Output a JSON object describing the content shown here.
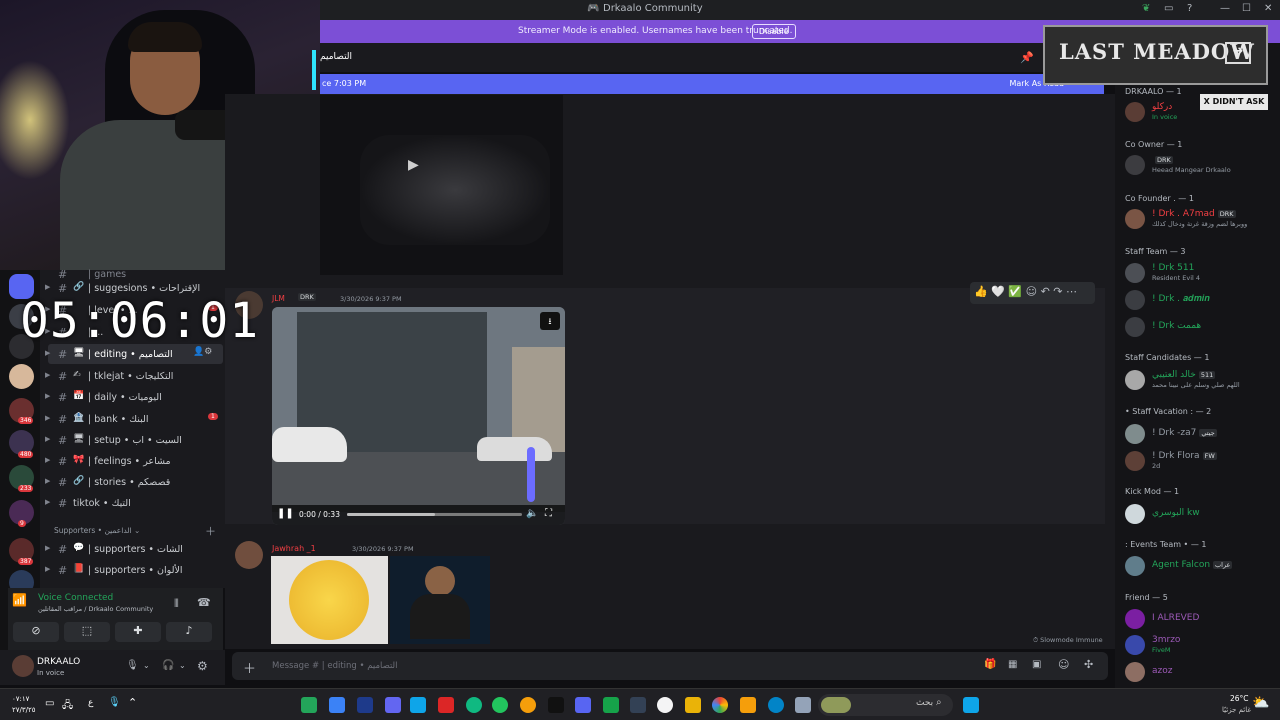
{
  "window": {
    "title": "Drkaalo Community",
    "controls": [
      "leaf-icon",
      "inbox-icon",
      "help-icon",
      "minimize-icon",
      "maximize-icon",
      "close-icon"
    ]
  },
  "banner": {
    "text": "Streamer Mode is enabled. Usernames have been truncated.",
    "button": "Disable",
    "color": "#7c4fd6"
  },
  "channel_header": {
    "name": "التصاميم"
  },
  "new_messages": {
    "left": "ce 7:03 PM",
    "right": "Mark As Read"
  },
  "timer": "05:06:01",
  "servers": [
    {
      "badge": ""
    },
    {
      "badge": ""
    },
    {
      "badge": ""
    },
    {
      "badge": "346"
    },
    {
      "badge": "480"
    },
    {
      "badge": "233"
    },
    {
      "badge": "9"
    },
    {
      "badge": "387"
    },
    {
      "badge": ""
    }
  ],
  "channels": [
    {
      "emoji": "🔗",
      "label": "| suggesions • الإقتراحات",
      "active": false,
      "badge": ""
    },
    {
      "emoji": "",
      "label": "| level • ...",
      "active": false,
      "badge": "1"
    },
    {
      "emoji": "",
      "label": "| ...",
      "active": false,
      "badge": ""
    },
    {
      "emoji": "🖥",
      "label": "| editing • التصاميم",
      "active": true,
      "badge": ""
    },
    {
      "emoji": "✍",
      "label": "| tklejat • التكليجات",
      "active": false,
      "badge": ""
    },
    {
      "emoji": "📅",
      "label": "| daily • اليوميات",
      "active": false,
      "badge": ""
    },
    {
      "emoji": "🏦",
      "label": "| bank • البنك",
      "active": false,
      "badge": "1"
    },
    {
      "emoji": "🖥",
      "label": "| setup • السيت • اب",
      "active": false,
      "badge": ""
    },
    {
      "emoji": "🎀",
      "label": "| feelings • مشاعر",
      "active": false,
      "badge": ""
    },
    {
      "emoji": "🔗",
      "label": "| stories • قصصكم",
      "active": false,
      "badge": ""
    },
    {
      "emoji": "",
      "label": "tiktok • التيك",
      "active": false,
      "badge": ""
    }
  ],
  "category": {
    "label": "Supporters • الداعمين"
  },
  "supporter_channels": [
    {
      "emoji": "💬",
      "label": "| supporters • الشات"
    },
    {
      "emoji": "📕",
      "label": "| supporters • الألوان"
    }
  ],
  "voice": {
    "status": "Voice Connected",
    "location": "مراقب المقاتلين / Drkaalo Community"
  },
  "user": {
    "name": "DRKAALO",
    "status": "In voice"
  },
  "messages": [
    {
      "author": "JLM",
      "tag": "DRK",
      "timestamp": "3/30/2026 9:37 PM",
      "video": {
        "time": "0:00 / 0:33",
        "progress": 0.0
      }
    },
    {
      "author": "Jawhrah _1",
      "timestamp": "3/30/2026 9:37 PM"
    }
  ],
  "slowmode": "Slowmode Immune",
  "input": {
    "placeholder": "Message # | editing • التصاميم"
  },
  "members": {
    "groups": [
      {
        "title": "DRKAALO — 1",
        "top": 0
      },
      {
        "title": "Co Owner — 1"
      },
      {
        "title": "Co Founder . — 1"
      },
      {
        "title": "Staff Team — 3"
      },
      {
        "title": "Staff Candidates — 1"
      },
      {
        "title": "• Staff Vacation : — 2"
      },
      {
        "title": "Kick Mod — 1"
      },
      {
        "title": ": Events Team • — 1"
      },
      {
        "title": "Friend — 5"
      }
    ],
    "list": [
      {
        "name": "دركلو",
        "sub": "In voice",
        "color": "#f23f43",
        "tag": ""
      },
      {
        "name": "",
        "sub": "Heead Mangear Drkaalo",
        "color": "#949ba4",
        "tag": "DRK"
      },
      {
        "name": "! Drk . A7mad",
        "sub": "ووبرها لضم وزقة غرتة ودخال كذلك",
        "color": "#f23f43",
        "tag": "DRK"
      },
      {
        "name": "! Drk 511",
        "sub": "Resident Evil 4",
        "color": "#23a55a",
        "tag": ""
      },
      {
        "name": "! Drk . 𝒂𝒅𝒎𝒊𝒏",
        "sub": "",
        "color": "#23a55a",
        "tag": ""
      },
      {
        "name": "! Drk هممت",
        "sub": "",
        "color": "#23a55a",
        "tag": ""
      },
      {
        "name": "خالد العتيبي",
        "sub": "اللهم صلي وسلم على نبينا محمد",
        "color": "#23a55a",
        "tag": "511"
      },
      {
        "name": "! Drk -za7",
        "sub": "",
        "color": "#949ba4",
        "tag": "جيتي"
      },
      {
        "name": "! Drk Flora",
        "sub": "2d",
        "color": "#949ba4",
        "tag": "FW"
      },
      {
        "name": "البوسري kw",
        "sub": "",
        "color": "#23a55a",
        "tag": ""
      },
      {
        "name": "Agent Falcon",
        "sub": "",
        "color": "#23a55a",
        "tag": "عراب"
      },
      {
        "name": "I ALREVED",
        "sub": "",
        "color": "#9b59b6",
        "tag": ""
      },
      {
        "name": "3mrzo",
        "sub": "FiveM",
        "color": "#9b59b6",
        "tag": ""
      },
      {
        "name": "azoz",
        "sub": "",
        "color": "#9b59b6",
        "tag": ""
      }
    ]
  },
  "overlay": {
    "last_meadow": "LAST MEADOW",
    "x_didnt_ask": "X DIDN'T ASK"
  },
  "taskbar": {
    "clock_time": "٠٧:١٧",
    "clock_date": "٢٧/٣/٢٥",
    "search": "بحث",
    "weather_temp": "26°C",
    "weather_desc": "غائم جزئيًا"
  }
}
